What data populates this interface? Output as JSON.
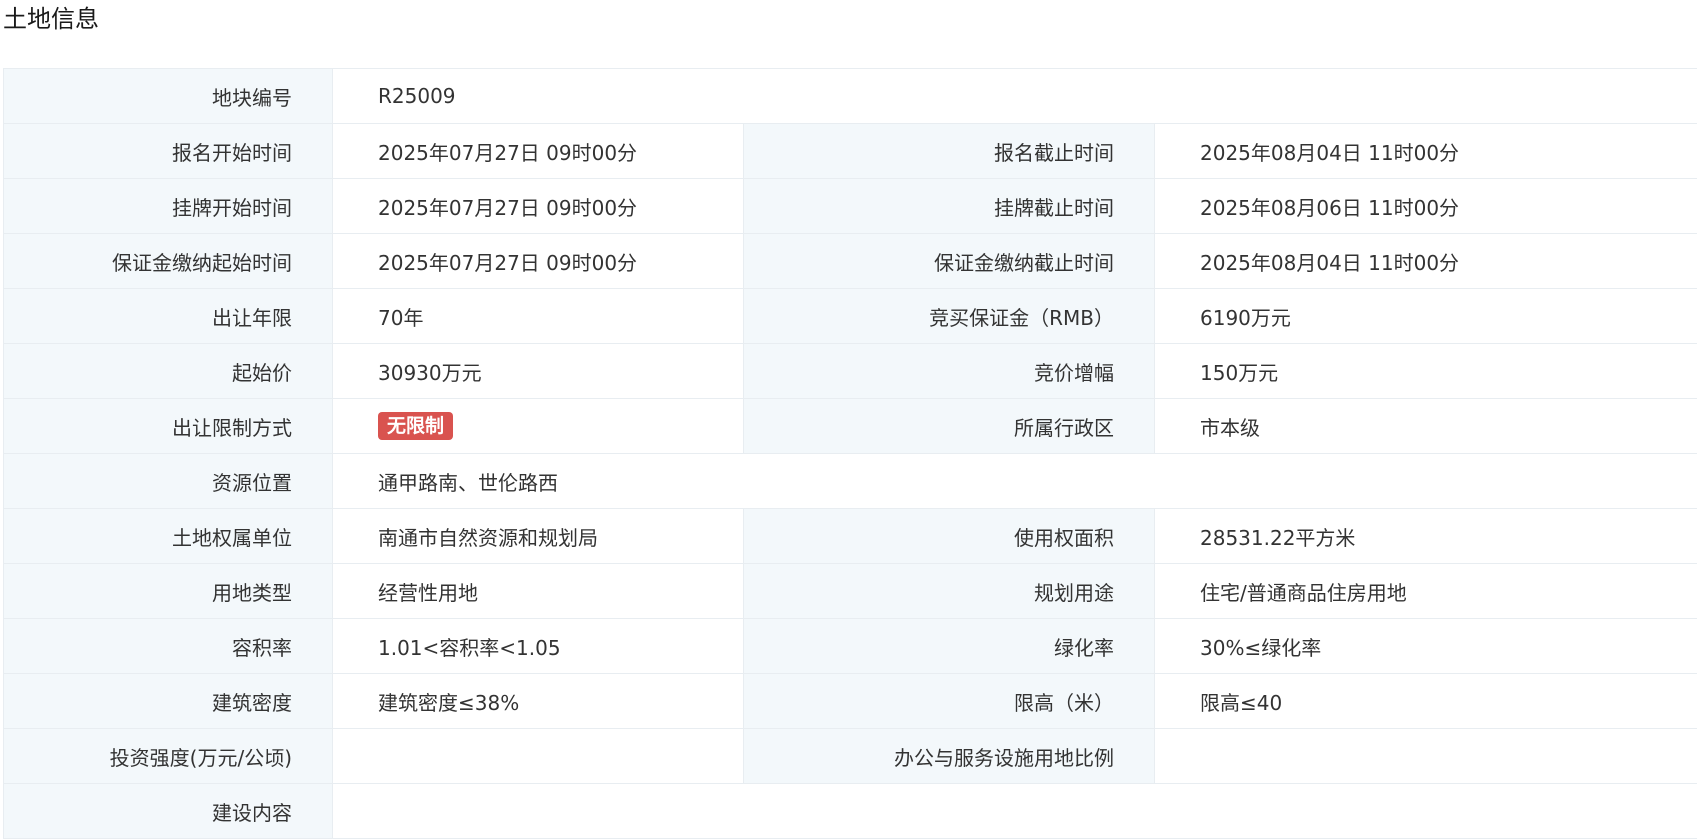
{
  "page": {
    "title": "土地信息"
  },
  "rows": {
    "r1": {
      "label": "地块编号",
      "value": "R25009"
    },
    "r2": {
      "label1": "报名开始时间",
      "value1": "2025年07月27日 09时00分",
      "label2": "报名截止时间",
      "value2": "2025年08月04日 11时00分"
    },
    "r3": {
      "label1": "挂牌开始时间",
      "value1": "2025年07月27日 09时00分",
      "label2": "挂牌截止时间",
      "value2": "2025年08月06日 11时00分"
    },
    "r4": {
      "label1": "保证金缴纳起始时间",
      "value1": "2025年07月27日 09时00分",
      "label2": "保证金缴纳截止时间",
      "value2": "2025年08月04日 11时00分"
    },
    "r5": {
      "label1": "出让年限",
      "value1": "70年",
      "label2": "竞买保证金（RMB）",
      "value2": "6190万元"
    },
    "r6": {
      "label1": "起始价",
      "value1": "30930万元",
      "label2": "竞价增幅",
      "value2": "150万元"
    },
    "r7": {
      "label1": "出让限制方式",
      "badge": "无限制",
      "badge_color": "#d9534f",
      "label2": "所属行政区",
      "value2": "市本级"
    },
    "r8": {
      "label": "资源位置",
      "value": "通甲路南、世伦路西"
    },
    "r9": {
      "label1": "土地权属单位",
      "value1": "南通市自然资源和规划局",
      "label2": "使用权面积",
      "value2": "28531.22平方米"
    },
    "r10": {
      "label1": "用地类型",
      "value1": "经营性用地",
      "label2": "规划用途",
      "value2": "住宅/普通商品住房用地"
    },
    "r11": {
      "label1": "容积率",
      "value1": "1.01<容积率<1.05",
      "label2": "绿化率",
      "value2": "30%≤绿化率"
    },
    "r12": {
      "label1": "建筑密度",
      "value1": "建筑密度≤38%",
      "label2": "限高（米）",
      "value2": "限高≤40"
    },
    "r13": {
      "label1": "投资强度(万元/公顷)",
      "value1": "",
      "label2": "办公与服务设施用地比例",
      "value2": ""
    },
    "r14": {
      "label": "建设内容",
      "value": ""
    }
  }
}
